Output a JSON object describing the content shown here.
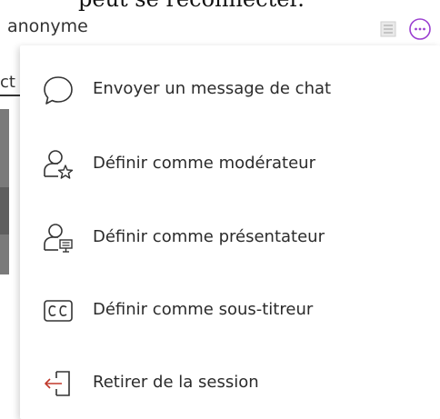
{
  "top_text": "peut se reconnecter.",
  "user_row": {
    "username": "anonyme",
    "status_icon": "list-icon",
    "more_icon": "more-options-icon",
    "accent_color": "#9b3fd1"
  },
  "background": {
    "tab_fragment": "ct"
  },
  "menu": {
    "items": [
      {
        "label": "Envoyer un message de chat",
        "icon": "chat-bubble-icon"
      },
      {
        "label": "Définir comme modérateur",
        "icon": "user-star-icon"
      },
      {
        "label": "Définir comme présentateur",
        "icon": "user-presenter-icon"
      },
      {
        "label": "Définir comme sous-titreur",
        "icon": "closed-caption-icon"
      },
      {
        "label": "Retirer de la session",
        "icon": "remove-from-session-icon",
        "icon_color": "#c0392b"
      }
    ]
  }
}
